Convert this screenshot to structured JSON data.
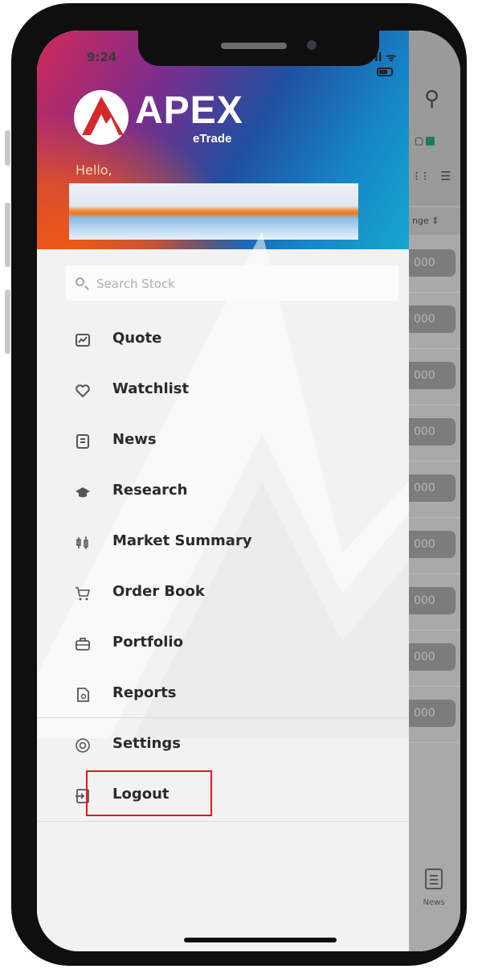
{
  "status_bar": {
    "time": "9:24",
    "indicators": "ıl ᯤ"
  },
  "brand": {
    "name": "APEX",
    "subtitle": "eTrade"
  },
  "greeting": "Hello,",
  "search": {
    "placeholder": "Search Stock",
    "value": ""
  },
  "menu": {
    "items": [
      {
        "label": "Quote",
        "icon": "chart-icon"
      },
      {
        "label": "Watchlist",
        "icon": "heart-icon"
      },
      {
        "label": "News",
        "icon": "news-icon"
      },
      {
        "label": "Research",
        "icon": "graduation-cap-icon"
      },
      {
        "label": "Market Summary",
        "icon": "candlestick-icon"
      },
      {
        "label": "Order Book",
        "icon": "cart-icon"
      },
      {
        "label": "Portfolio",
        "icon": "briefcase-icon"
      },
      {
        "label": "Reports",
        "icon": "report-icon"
      }
    ],
    "secondary": [
      {
        "label": "Settings",
        "icon": "settings-icon"
      },
      {
        "label": "Logout",
        "icon": "logout-icon"
      }
    ]
  },
  "background_app": {
    "column_header": "nge ⇕",
    "row_value": "000",
    "bottom_tab": "News"
  },
  "colors": {
    "highlight_box": "#e0191e",
    "drawer_background": "#f2f2f2"
  }
}
